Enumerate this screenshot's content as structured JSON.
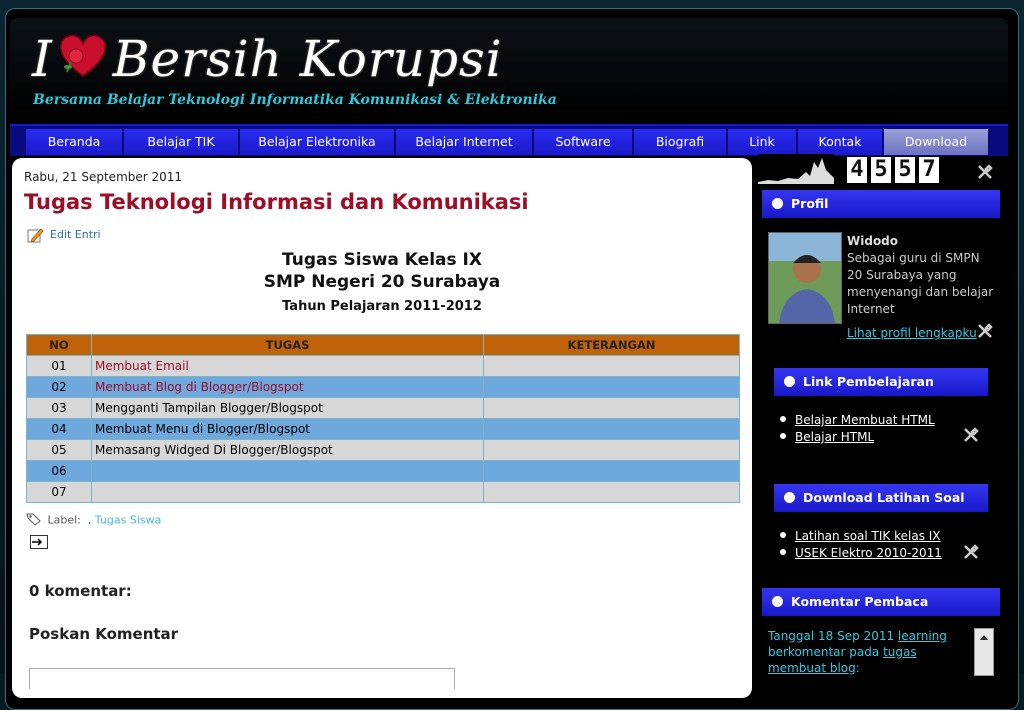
{
  "header": {
    "logo_i": "I",
    "logo_text": "Bersih Korupsi",
    "tagline": "Bersama Belajar Teknologi Informatika Komunikasi & Elektronika"
  },
  "nav": [
    {
      "label": "Beranda"
    },
    {
      "label": "Belajar TIK"
    },
    {
      "label": "Belajar Elektronika"
    },
    {
      "label": "Belajar Internet"
    },
    {
      "label": "Software"
    },
    {
      "label": "Biografi"
    },
    {
      "label": "Link"
    },
    {
      "label": "Kontak"
    },
    {
      "label": "Download"
    }
  ],
  "post": {
    "date": "Rabu, 21 September 2011",
    "title": "Tugas Teknologi Informasi dan Komunikasi",
    "edit_label": "Edit Entri",
    "heading1": "Tugas Siswa Kelas IX",
    "heading2": "SMP Negeri 20 Surabaya",
    "heading3": "Tahun Pelajaran 2011-2012",
    "table": {
      "headers": [
        "NO",
        "TUGAS",
        "KETERANGAN"
      ],
      "rows": [
        {
          "no": "01",
          "task": "Membuat Email",
          "link": true
        },
        {
          "no": "02",
          "task": "Membuat Blog di Blogger/Blogspot",
          "link": true
        },
        {
          "no": "03",
          "task": "Mengganti Tampilan Blogger/Blogspot",
          "link": false
        },
        {
          "no": "04",
          "task": "Membuat Menu di Blogger/Blogspot",
          "link": false
        },
        {
          "no": "05",
          "task": "Memasang Widged Di Blogger/Blogspot",
          "link": false
        },
        {
          "no": "06",
          "task": "",
          "link": false
        },
        {
          "no": "07",
          "task": "",
          "link": false
        }
      ]
    },
    "label_prefix": "Label:",
    "label_sep": ",",
    "label_tag": "Tugas Siswa",
    "comments_count": "0 komentar:",
    "post_comment": "Poskan Komentar"
  },
  "sidebar": {
    "counter_digits": [
      "4",
      "5",
      "5",
      "7"
    ],
    "profile": {
      "title": "Profil",
      "name": "Widodo",
      "desc": "Sebagai guru di SMPN 20 Surabaya yang menyenangi dan belajar Internet",
      "link": "Lihat profil lengkapku"
    },
    "link_pembelajaran": {
      "title": "Link Pembelajaran",
      "items": [
        "Belajar Membuat HTML",
        "Belajar HTML"
      ]
    },
    "download": {
      "title": "Download Latihan Soal",
      "items": [
        "Latihan soal TIK kelas IX",
        "USEK Elektro 2010-2011"
      ]
    },
    "komentar": {
      "title": "Komentar Pembaca",
      "prefix": "Tanggal 18 Sep 2011",
      "author": "learning",
      "mid": "berkomentar pada",
      "post_link": "tugas membuat blog",
      "suffix": ":"
    }
  },
  "colors": {
    "nav_blue": "#2b2bf2",
    "title_red": "#9e0c27",
    "table_header": "#c0620a",
    "row_gray": "#d7d7d7",
    "row_blue": "#6fa8dc",
    "cyan_link": "#36c8e0"
  }
}
